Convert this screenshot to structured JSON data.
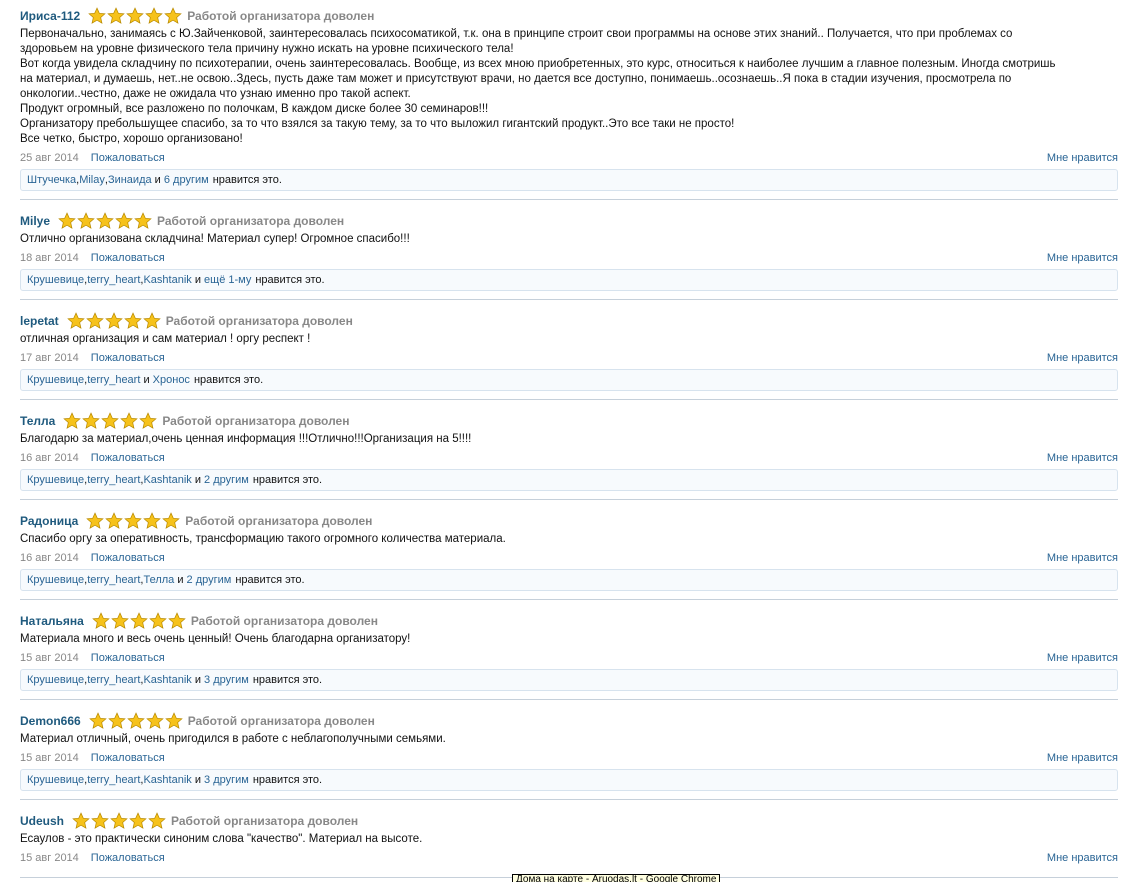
{
  "verdict_label": "Работой организатора доволен",
  "report_label": "Пожаловаться",
  "like_label": "Мне нравится",
  "likes_suffix": "нравится это.",
  "reviews": [
    {
      "author": "Ириса-112",
      "rating": 5,
      "text": [
        "Первоначально, занимаясь с Ю.Зайченковой, заинтересовалась психосоматикой, т.к. она в принципе строит свои программы на основе этих знаний.. Получается, что при проблемах со",
        "здоровьем на уровне физического тела причину нужно искать на уровне психического тела!",
        "Вот когда увидела складчину по психотерапии, очень заинтересовалась. Вообще, из всех мною приобретенных, это курс, относиться к наиболее лучшим а главное полезным. Иногда смотришь",
        "на материал, и думаешь, нет..не освою..Здесь, пусть даже там может и присутствуют врачи, но дается все доступно, понимаешь..осознаешь..Я пока в стадии изучения, просмотрела по",
        "онкологии..честно, даже не ожидала что узнаю именно про такой аспект.",
        "Продукт огромный, все разложено по полочкам, В каждом диске более 30 семинаров!!!",
        "Организатору пребольшущее спасибо, за то что взялся за такую тему, за то что выложил гигантский продукт..Это все таки не просто!",
        "Все четко, быстро, хорошо организовано!"
      ],
      "date": "25 авг 2014",
      "likers": [
        "Штучечка",
        "Milay",
        "Зинаида"
      ],
      "others": "6 другим"
    },
    {
      "author": "Milye",
      "rating": 5,
      "text": [
        "Отлично организована складчина! Материал супер! Огромное спасибо!!!"
      ],
      "date": "18 авг 2014",
      "likers": [
        "Крушевице",
        "terry_heart",
        "Kashtanik"
      ],
      "others": "ещё 1-му"
    },
    {
      "author": "lepetat",
      "rating": 5,
      "text": [
        "отличная организация и сам материал ! оргу респект !"
      ],
      "date": "17 авг 2014",
      "likers": [
        "Крушевице",
        "terry_heart"
      ],
      "others": "Хронос"
    },
    {
      "author": "Телла",
      "rating": 5,
      "text": [
        "Благодарю за материал,очень ценная информация !!!Отлично!!!Организация на 5!!!!"
      ],
      "date": "16 авг 2014",
      "likers": [
        "Крушевице",
        "terry_heart",
        "Kashtanik"
      ],
      "others": "2 другим"
    },
    {
      "author": "Радоница",
      "rating": 5,
      "text": [
        "Спасибо оргу за оперативность, трансформацию такого огромного количества материала."
      ],
      "date": "16 авг 2014",
      "likers": [
        "Крушевице",
        "terry_heart",
        "Телла"
      ],
      "others": "2 другим"
    },
    {
      "author": "Натальяна",
      "rating": 5,
      "text": [
        "Материала много и весь очень ценный! Очень благодарна организатору!"
      ],
      "date": "15 авг 2014",
      "likers": [
        "Крушевице",
        "terry_heart",
        "Kashtanik"
      ],
      "others": "3 другим"
    },
    {
      "author": "Demon666",
      "rating": 5,
      "text": [
        "Материал отличный, очень пригодился в работе с неблагополучными семьями."
      ],
      "date": "15 авг 2014",
      "likers": [
        "Крушевице",
        "terry_heart",
        "Kashtanik"
      ],
      "others": "3 другим"
    },
    {
      "author": "Udeush",
      "rating": 5,
      "text": [
        "Есаулов - это практически синоним слова \"качество\". Материал на высоте."
      ],
      "date": "15 авг 2014",
      "likers": [],
      "others": ""
    }
  ],
  "tooltip": "Дома на карте - Aruodas.lt - Google Chrome",
  "icons": {
    "star": "star-icon"
  },
  "colors": {
    "star_fill": "#f6c21b",
    "link": "#2a6595",
    "author": "#1f5a7e"
  }
}
